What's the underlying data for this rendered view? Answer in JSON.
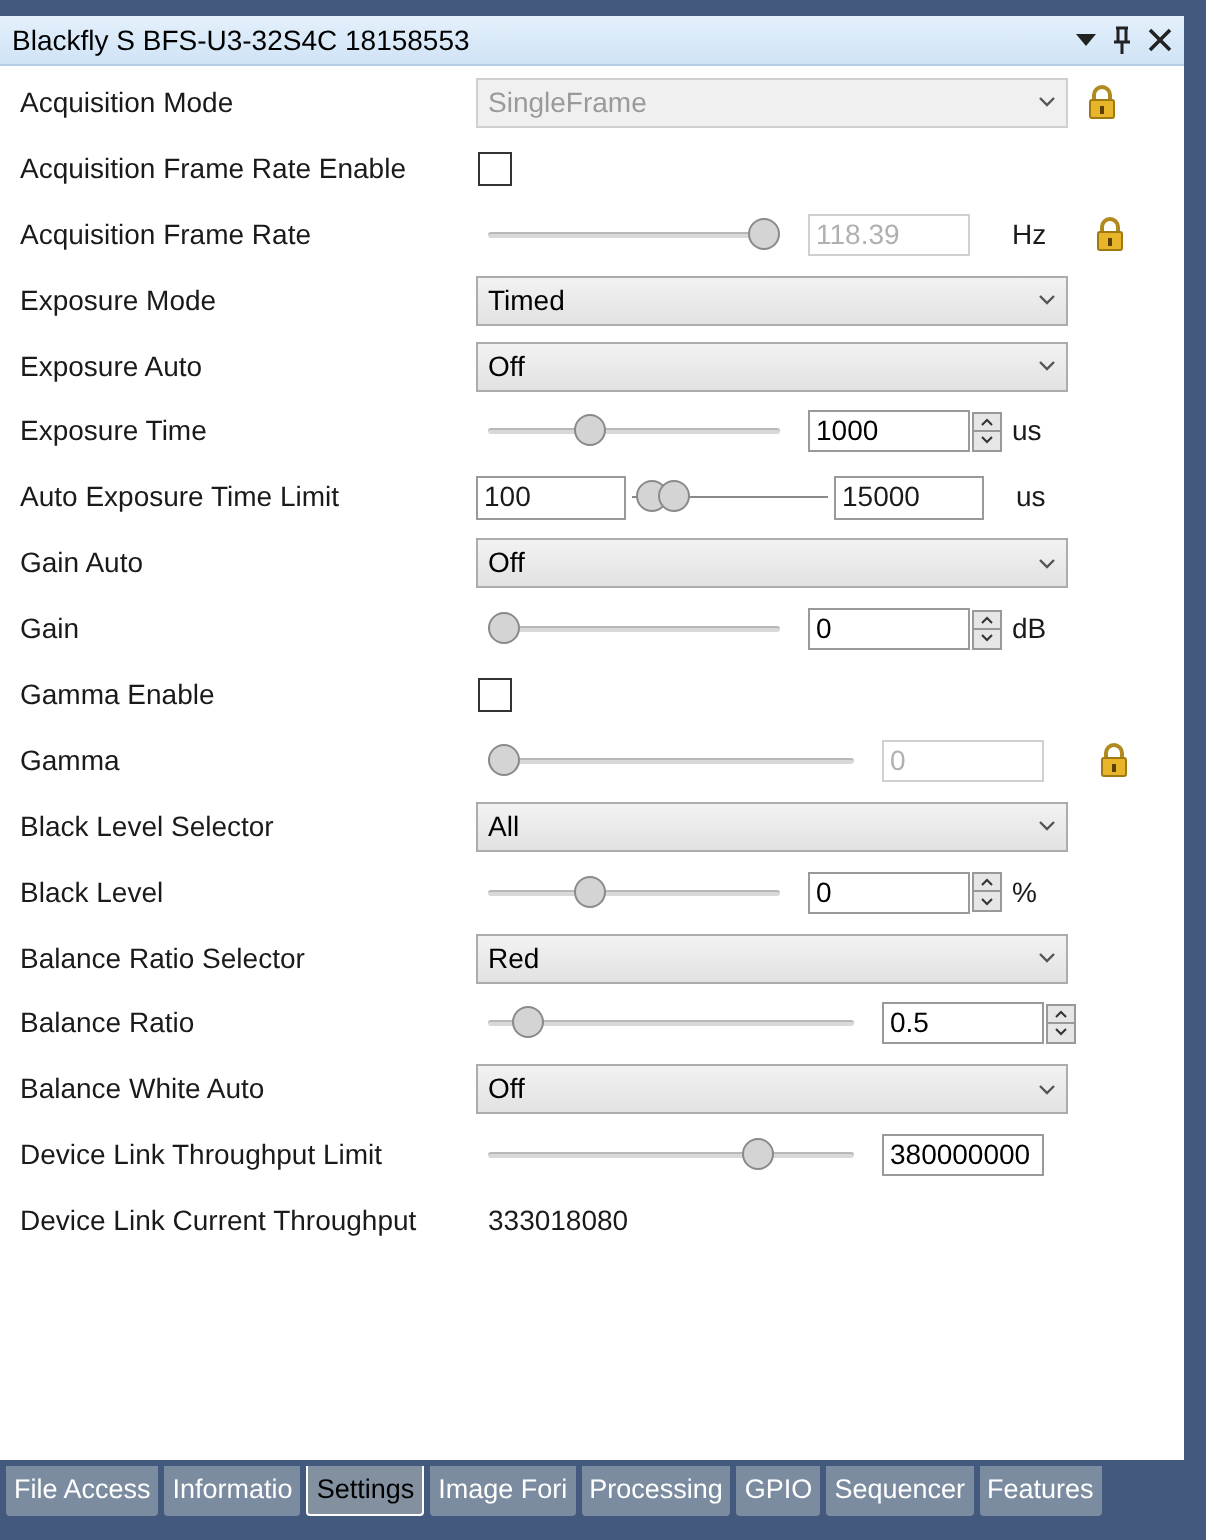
{
  "window": {
    "title": "Blackfly S BFS-U3-32S4C 18158553"
  },
  "rows": [
    {
      "kind": "combo",
      "label": "Acquisition Mode",
      "value": "SingleFrame",
      "disabled": true,
      "locked": true
    },
    {
      "kind": "checkbox",
      "label": "Acquisition Frame Rate Enable",
      "checked": false
    },
    {
      "kind": "slider",
      "label": "Acquisition Frame Rate",
      "level": 1.0,
      "value": "118.39",
      "unit": "Hz",
      "spin": false,
      "disabled": true,
      "locked": true
    },
    {
      "kind": "combo",
      "label": "Exposure Mode",
      "value": "Timed",
      "disabled": false,
      "locked": false
    },
    {
      "kind": "combo",
      "label": "Exposure Auto",
      "value": "Off",
      "disabled": false,
      "locked": false
    },
    {
      "kind": "slider",
      "label": "Exposure Time",
      "level": 0.33,
      "value": "1000",
      "unit": "us",
      "spin": true,
      "disabled": false,
      "locked": false
    },
    {
      "kind": "range",
      "label": "Auto Exposure Time Limit",
      "min": "100",
      "max": "15000",
      "thumbs": [
        {
          "level": 0.03
        },
        {
          "level": 0.16
        }
      ],
      "unit": "us"
    },
    {
      "kind": "combo",
      "label": "Gain Auto",
      "value": "Off",
      "disabled": false,
      "locked": false
    },
    {
      "kind": "slider",
      "label": "Gain",
      "level": 0,
      "value": "0",
      "unit": "dB",
      "spin": true,
      "disabled": false,
      "locked": false
    },
    {
      "kind": "checkbox",
      "label": "Gamma Enable",
      "checked": false
    },
    {
      "kind": "slider",
      "label": "Gamma",
      "level": 0,
      "value": "0",
      "spin": false,
      "disabled": true,
      "locked": true
    },
    {
      "kind": "combo",
      "label": "Black Level Selector",
      "value": "All",
      "disabled": false,
      "locked": false
    },
    {
      "kind": "slider",
      "label": "Black Level",
      "level": 0.33,
      "value": "0",
      "unit": "%",
      "spin": true,
      "disabled": false,
      "locked": false
    },
    {
      "kind": "combo",
      "label": "Balance Ratio Selector",
      "value": "Red",
      "disabled": false,
      "locked": false
    },
    {
      "kind": "slider",
      "label": "Balance Ratio",
      "level": 0.07,
      "value": "0.5",
      "spin": true,
      "disabled": false,
      "locked": false
    },
    {
      "kind": "combo",
      "label": "Balance White Auto",
      "value": "Off",
      "disabled": false,
      "locked": false
    },
    {
      "kind": "slider",
      "label": "Device Link Throughput Limit",
      "level": 0.76,
      "value": "380000000",
      "spin": false,
      "disabled": false,
      "locked": false
    },
    {
      "kind": "text",
      "label": "Device Link Current Throughput",
      "value": "333018080"
    }
  ],
  "tabs": [
    {
      "label": "File Access",
      "selected": false
    },
    {
      "label": "Informatio",
      "selected": false
    },
    {
      "label": "Settings",
      "selected": true
    },
    {
      "label": "Image Fori",
      "selected": false
    },
    {
      "label": "Processing",
      "selected": false
    },
    {
      "label": "GPIO",
      "selected": false
    },
    {
      "label": "Sequencer",
      "selected": false
    },
    {
      "label": "Features",
      "selected": false
    }
  ]
}
